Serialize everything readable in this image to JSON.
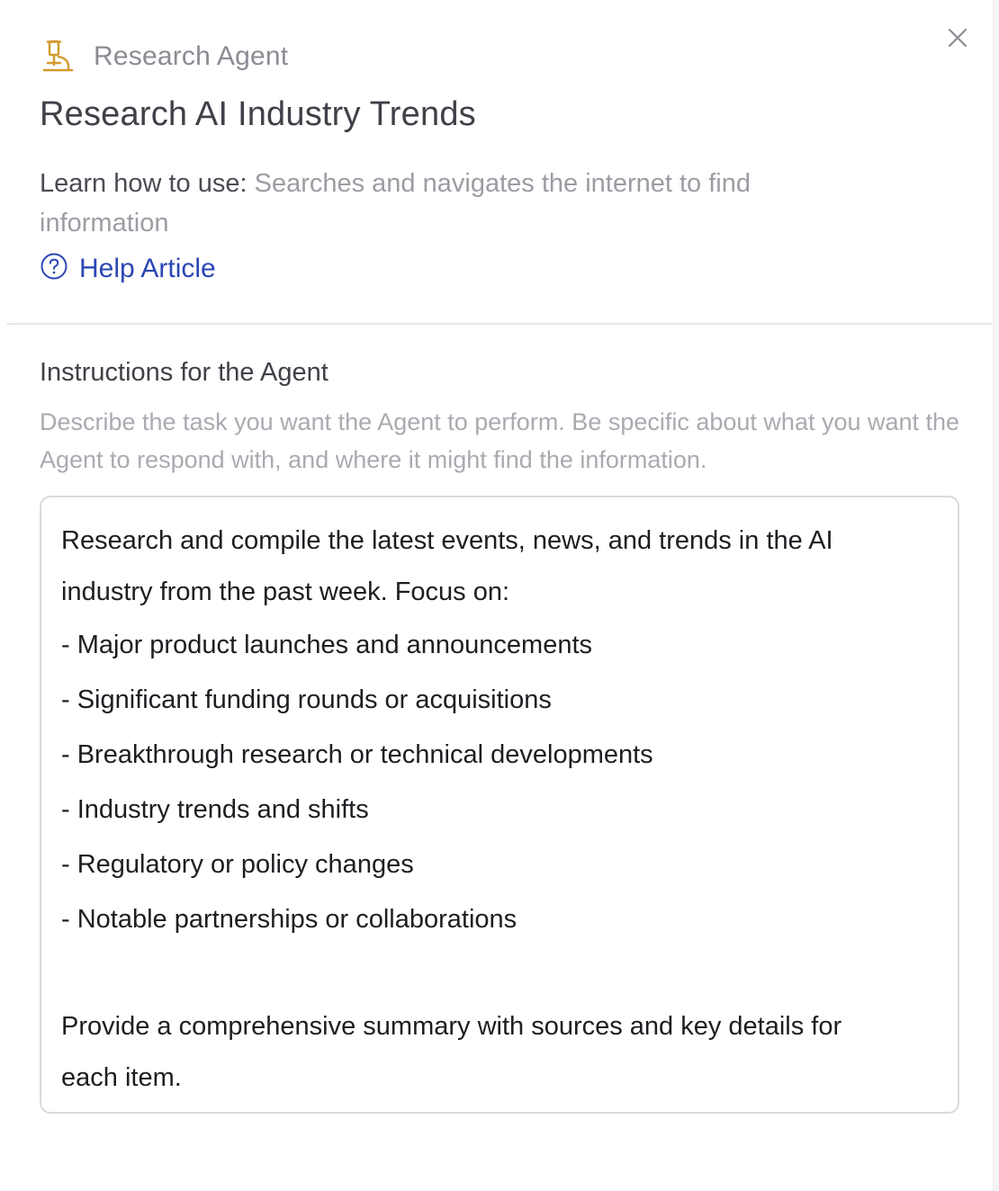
{
  "header": {
    "agent_type": "Research Agent",
    "icon": "flask-icon",
    "close_icon": "close-icon"
  },
  "title": "Research AI Industry Trends",
  "learn": {
    "label": "Learn how to use:",
    "description": "Searches and navigates the internet to find information"
  },
  "help": {
    "icon": "question-circle-icon",
    "label": "Help Article"
  },
  "instructions": {
    "heading": "Instructions for the Agent",
    "description": "Describe the task you want the Agent to perform. Be specific about what you want the Agent to respond with, and where it might find the information.",
    "intro_line_1": "Research and compile the latest events, news, and trends in the AI",
    "intro_line_2": "industry from the past week. Focus on:",
    "bullets": [
      "- Major product launches and announcements",
      "- Significant funding rounds or acquisitions",
      "- Breakthrough research or technical developments",
      "- Industry trends and shifts",
      "- Regulatory or policy changes",
      "- Notable partnerships or collaborations"
    ],
    "closing_line_1": "Provide a comprehensive summary with sources and key details for",
    "closing_line_2": "each item."
  },
  "colors": {
    "accent_icon": "#d39a2b",
    "link": "#2b46b5",
    "title": "#3f4148",
    "muted": "#9b9da3"
  }
}
